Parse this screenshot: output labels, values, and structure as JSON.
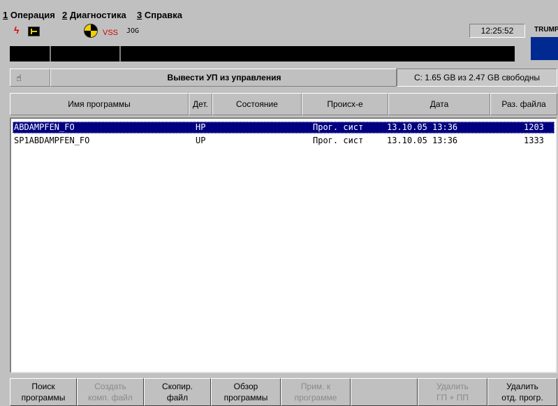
{
  "menu": [
    {
      "num": "1",
      "label": "Операция"
    },
    {
      "num": "2",
      "label": "Диагностика"
    },
    {
      "num": "3",
      "label": "Справка"
    }
  ],
  "status": {
    "vss_label": "VSS",
    "mode": "JOG",
    "time": "12:25:52",
    "brand": "TRUMPF",
    "brand_color": "#002a92",
    "alarm_color": "#e00000"
  },
  "title": {
    "text": "Вывести УП из управления",
    "disk_info": "C: 1.65 GB из 2.47 GB свободны"
  },
  "columns": [
    "Имя программы",
    "Дет.",
    "Состояние",
    "Происх-е",
    "Дата",
    "Раз. файла"
  ],
  "rows": [
    {
      "name": "ABDAMPFEN_FO",
      "det": "HP",
      "state": "",
      "origin": "Прог. сист",
      "date": "13.10.05 13:36",
      "size": "1203",
      "selected": true
    },
    {
      "name": "SP1ABDAMPFEN_FO",
      "det": "UP",
      "state": "",
      "origin": "Прог. сист",
      "date": "13.10.05 13:36",
      "size": "1333",
      "selected": false
    }
  ],
  "softkeys": [
    {
      "line1": "Поиск",
      "line2": "программы",
      "enabled": true
    },
    {
      "line1": "Создать",
      "line2": "комп. файл",
      "enabled": false
    },
    {
      "line1": "Скопир.",
      "line2": "файл",
      "enabled": true
    },
    {
      "line1": "Обзор",
      "line2": "программы",
      "enabled": true
    },
    {
      "line1": "Прим. к",
      "line2": "программе",
      "enabled": false
    },
    {
      "line1": "",
      "line2": "",
      "enabled": false
    },
    {
      "line1": "Удалить",
      "line2": "ГП + ПП",
      "enabled": false
    },
    {
      "line1": "Удалить",
      "line2": "отд. прогр.",
      "enabled": true
    }
  ],
  "selection_color": "#000080"
}
